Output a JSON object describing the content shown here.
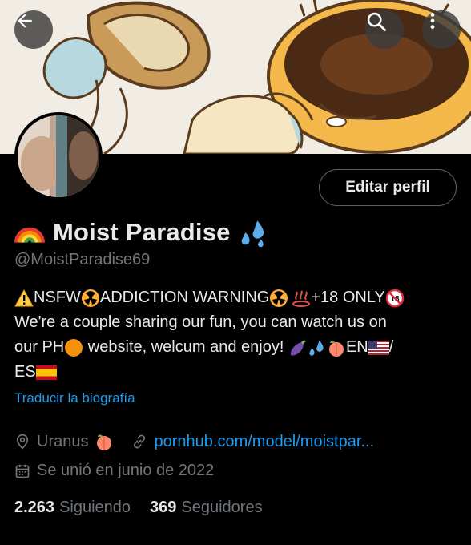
{
  "header": {
    "back_icon": "arrow-left-icon",
    "search_icon": "search-icon",
    "more_icon": "more-vertical-icon"
  },
  "profile": {
    "edit_label": "Editar perfil",
    "name_prefix_emoji": "rainbow-emoji",
    "display_name": "Moist Paradise",
    "name_suffix_emoji": "sweat-droplets-emoji",
    "handle": "@MoistParadise69",
    "bio": {
      "line1_a": "NSFW ",
      "line1_b": "ADDICTION WARNING",
      "line1_c": "+18 ONLY",
      "line2": "We're a couple sharing our fun, you can watch us on",
      "line3_a": "our PH",
      "line3_b": " website, welcum and enjoy! ",
      "line3_c": " EN",
      "line3_d": "/",
      "line4": "ES"
    },
    "translate_label": "Traducir la biografía",
    "location": "Uranus",
    "website": "pornhub.com/model/moistpar...",
    "joined": "Se unió en junio de 2022",
    "following_count": "2.263",
    "following_label": "Siguiendo",
    "followers_count": "369",
    "followers_label": "Seguidores"
  },
  "colors": {
    "background": "#000000",
    "text": "#e7e9ea",
    "secondary": "#71767b",
    "accent": "#1d9bf0"
  }
}
